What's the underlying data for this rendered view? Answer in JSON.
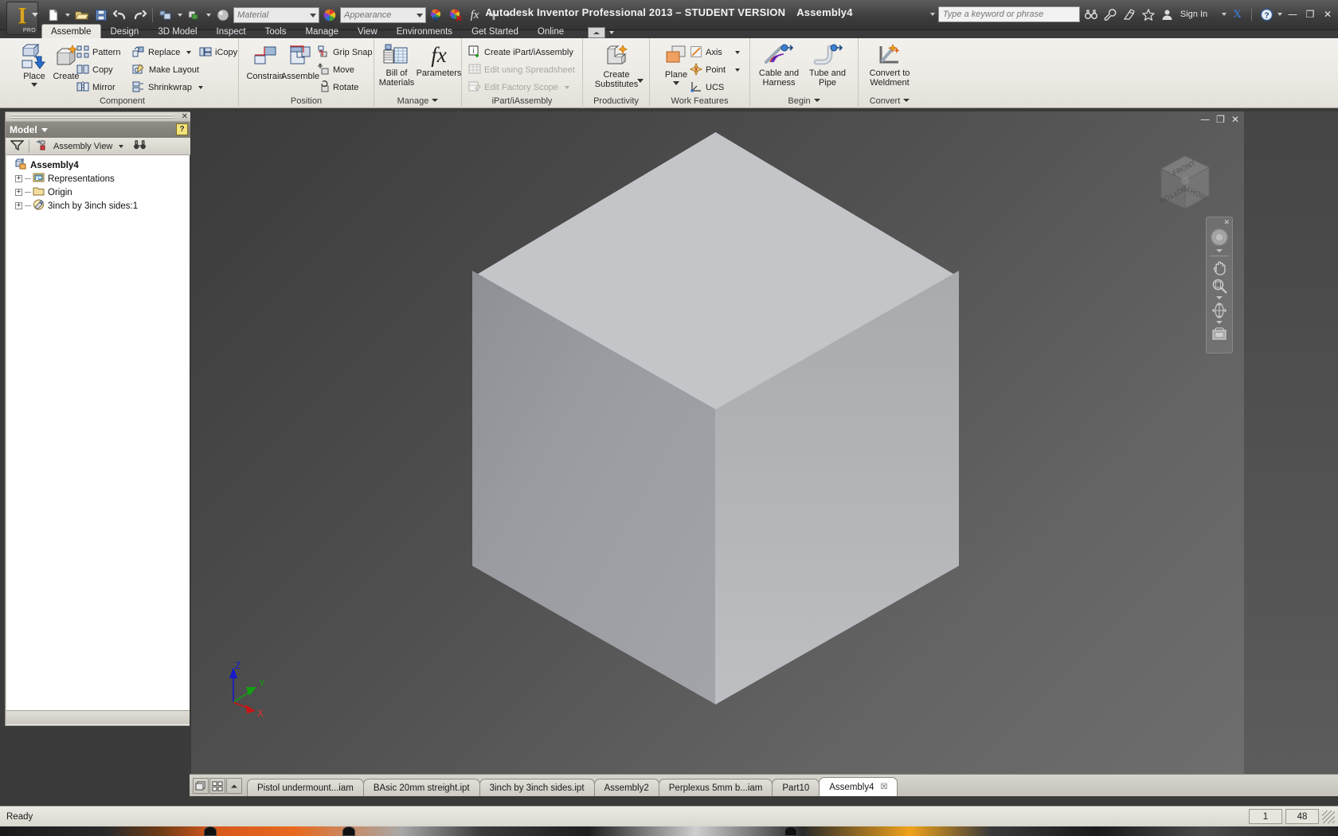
{
  "app": {
    "title": "Autodesk Inventor Professional 2013 – STUDENT VERSION",
    "document_title": "Assembly4",
    "logo_text": "I",
    "logo_badge": "PRO"
  },
  "quick_access": {
    "items": [
      {
        "name": "new-file",
        "icon": "new-document-icon",
        "has_dropdown": true
      },
      {
        "name": "open-file",
        "icon": "open-folder-icon",
        "has_dropdown": false
      },
      {
        "name": "save",
        "icon": "save-disk-icon",
        "has_dropdown": false
      },
      {
        "name": "undo",
        "icon": "undo-arrow-icon",
        "has_dropdown": false
      },
      {
        "name": "redo",
        "icon": "redo-arrow-icon",
        "has_dropdown": false
      },
      {
        "name": "select",
        "icon": "select-icon",
        "has_dropdown": true
      },
      {
        "name": "return",
        "icon": "return-icon",
        "has_dropdown": true
      },
      {
        "name": "material-sphere",
        "icon": "material-sphere-icon",
        "has_dropdown": false
      }
    ],
    "material_placeholder": "Material",
    "appearance_placeholder": "Appearance",
    "fx_label": "fx"
  },
  "titlebar_right": {
    "search_placeholder": "Type a keyword or phrase",
    "icons": [
      "binoculars-icon",
      "wrench-icon",
      "satellite-icon",
      "star-icon",
      "user-icon"
    ],
    "sign_in_label": "Sign In",
    "exchange_label": "X",
    "help_label": "?",
    "minimize": "—",
    "maximize": "❐",
    "close": "✕"
  },
  "ribbon": {
    "tabs": [
      {
        "label": "Assemble",
        "active": true
      },
      {
        "label": "Design",
        "active": false
      },
      {
        "label": "3D Model",
        "active": false
      },
      {
        "label": "Inspect",
        "active": false
      },
      {
        "label": "Tools",
        "active": false
      },
      {
        "label": "Manage",
        "active": false
      },
      {
        "label": "View",
        "active": false
      },
      {
        "label": "Environments",
        "active": false
      },
      {
        "label": "Get Started",
        "active": false
      },
      {
        "label": "Online",
        "active": false
      }
    ],
    "panels": [
      {
        "name": "component",
        "title": "Component",
        "has_caret": false,
        "big_buttons": [
          {
            "label": "Place",
            "icon": "place-component-icon",
            "has_dropdown": true
          },
          {
            "label": "Create",
            "icon": "create-component-icon",
            "has_dropdown": false
          }
        ],
        "small_buttons": [
          {
            "label": "Pattern",
            "icon": "pattern-icon",
            "has_dropdown": false,
            "enabled": true
          },
          {
            "label": "Copy",
            "icon": "copy-icon",
            "has_dropdown": false,
            "enabled": true
          },
          {
            "label": "Mirror",
            "icon": "mirror-icon",
            "has_dropdown": false,
            "enabled": true
          },
          {
            "label": "Replace",
            "icon": "replace-icon",
            "has_dropdown": true,
            "enabled": true
          },
          {
            "label": "Make Layout",
            "icon": "make-layout-icon",
            "has_dropdown": false,
            "enabled": true
          },
          {
            "label": "Shrinkwrap",
            "icon": "shrinkwrap-icon",
            "has_dropdown": true,
            "enabled": true
          },
          {
            "label": "iCopy",
            "icon": "icopy-icon",
            "has_dropdown": false,
            "enabled": true
          }
        ]
      },
      {
        "name": "position",
        "title": "Position",
        "has_caret": false,
        "big_buttons": [
          {
            "label": "Constrain",
            "icon": "constrain-icon",
            "has_dropdown": false
          },
          {
            "label": "Assemble",
            "icon": "assemble-icon",
            "has_dropdown": false
          }
        ],
        "small_buttons": [
          {
            "label": "Grip Snap",
            "icon": "grip-snap-icon",
            "has_dropdown": false,
            "enabled": true
          },
          {
            "label": "Move",
            "icon": "move-icon",
            "has_dropdown": false,
            "enabled": true
          },
          {
            "label": "Rotate",
            "icon": "rotate-icon",
            "has_dropdown": false,
            "enabled": true
          }
        ]
      },
      {
        "name": "manage",
        "title": "Manage",
        "has_caret": true,
        "big_buttons": [
          {
            "label": "Bill of\nMaterials",
            "icon": "bill-of-materials-icon",
            "has_dropdown": false
          },
          {
            "label": "Parameters",
            "icon": "parameters-fx-icon",
            "has_dropdown": false
          }
        ],
        "small_buttons": []
      },
      {
        "name": "ipart-iassembly",
        "title": "iPart/iAssembly",
        "has_caret": false,
        "big_buttons": [],
        "small_buttons": [
          {
            "label": "Create iPart/iAssembly",
            "icon": "create-ipart-icon",
            "has_dropdown": false,
            "enabled": true
          },
          {
            "label": "Edit using Spreadsheet",
            "icon": "edit-spreadsheet-icon",
            "has_dropdown": false,
            "enabled": false
          },
          {
            "label": "Edit Factory Scope",
            "icon": "edit-factory-scope-icon",
            "has_dropdown": true,
            "enabled": false
          }
        ]
      },
      {
        "name": "productivity",
        "title": "Productivity",
        "has_caret": false,
        "big_buttons": [
          {
            "label": "Create\nSubstitutes",
            "icon": "create-substitutes-icon",
            "has_dropdown": true
          }
        ],
        "small_buttons": []
      },
      {
        "name": "work-features",
        "title": "Work Features",
        "has_caret": false,
        "big_buttons": [
          {
            "label": "Plane",
            "icon": "work-plane-icon",
            "has_dropdown": true
          }
        ],
        "small_buttons": [
          {
            "label": "Axis",
            "icon": "work-axis-icon",
            "has_dropdown": true,
            "enabled": true
          },
          {
            "label": "Point",
            "icon": "work-point-icon",
            "has_dropdown": true,
            "enabled": true
          },
          {
            "label": "UCS",
            "icon": "ucs-icon",
            "has_dropdown": false,
            "enabled": true
          }
        ]
      },
      {
        "name": "begin",
        "title": "Begin",
        "has_caret": true,
        "big_buttons": [
          {
            "label": "Cable and\nHarness",
            "icon": "cable-harness-icon",
            "has_dropdown": false
          },
          {
            "label": "Tube and\nPipe",
            "icon": "tube-pipe-icon",
            "has_dropdown": false
          }
        ],
        "small_buttons": []
      },
      {
        "name": "convert",
        "title": "Convert",
        "has_caret": true,
        "big_buttons": [
          {
            "label": "Convert to\nWeldment",
            "icon": "convert-weldment-icon",
            "has_dropdown": false
          }
        ],
        "small_buttons": []
      }
    ]
  },
  "browser": {
    "panel_title": "Model",
    "filter_icon": "filter-funnel-icon",
    "view_selector": "Assembly View",
    "find_icon": "binoculars-find-icon",
    "help_badge": "?",
    "close_label": "✕",
    "tree": [
      {
        "label": "Assembly4",
        "icon": "assembly-icon",
        "level": 0,
        "expandable": false,
        "expander": "",
        "bold": true
      },
      {
        "label": "Representations",
        "icon": "representations-icon",
        "level": 1,
        "expandable": true,
        "expander": "+",
        "bold": false
      },
      {
        "label": "Origin",
        "icon": "folder-icon",
        "level": 1,
        "expandable": true,
        "expander": "+",
        "bold": false
      },
      {
        "label": "3inch by 3inch sides:1",
        "icon": "part-icon",
        "level": 1,
        "expandable": true,
        "expander": "+",
        "bold": false
      }
    ]
  },
  "viewport": {
    "minimize": "—",
    "restore": "❐",
    "close": "✕",
    "viewcube": {
      "front_label": "FRONT",
      "right_label": "RIGHT",
      "bottom_label": "BOTTOM"
    },
    "triad": {
      "z_label": "Z",
      "y_label": "Y",
      "x_label": "X",
      "z_color": "#1818c8",
      "y_color": "#12a012",
      "x_color": "#c81414"
    },
    "navbar": {
      "close_label": "✕",
      "items": [
        {
          "name": "steering-wheel-icon",
          "has_caret": true
        },
        {
          "name": "pan-hand-icon",
          "has_caret": false
        },
        {
          "name": "zoom-magnifier-icon",
          "has_caret": true
        },
        {
          "name": "orbit-icon",
          "has_caret": true
        },
        {
          "name": "look-at-icon",
          "has_caret": false
        }
      ]
    },
    "model_colors": {
      "top_face": "#c3c5c9",
      "left_face": "#989aa0",
      "right_face": "#b2b4b8",
      "background_dark": "#3b3b3b",
      "background_light": "#6e6e6e"
    }
  },
  "doc_tabs": {
    "controls": [
      "cascade-windows-icon",
      "tile-windows-icon",
      "scroll-up-icon"
    ],
    "tabs": [
      {
        "label": "Pistol undermount...iam",
        "active": false,
        "closable": false
      },
      {
        "label": "BAsic 20mm streight.ipt",
        "active": false,
        "closable": false
      },
      {
        "label": "3inch by 3inch sides.ipt",
        "active": false,
        "closable": false
      },
      {
        "label": "Assembly2",
        "active": false,
        "closable": false
      },
      {
        "label": "Perplexus 5mm b...iam",
        "active": false,
        "closable": false
      },
      {
        "label": "Part10",
        "active": false,
        "closable": false
      },
      {
        "label": "Assembly4",
        "active": true,
        "closable": true,
        "close_label": "☒"
      }
    ]
  },
  "status": {
    "message": "Ready",
    "cells": [
      "1",
      "48"
    ]
  }
}
